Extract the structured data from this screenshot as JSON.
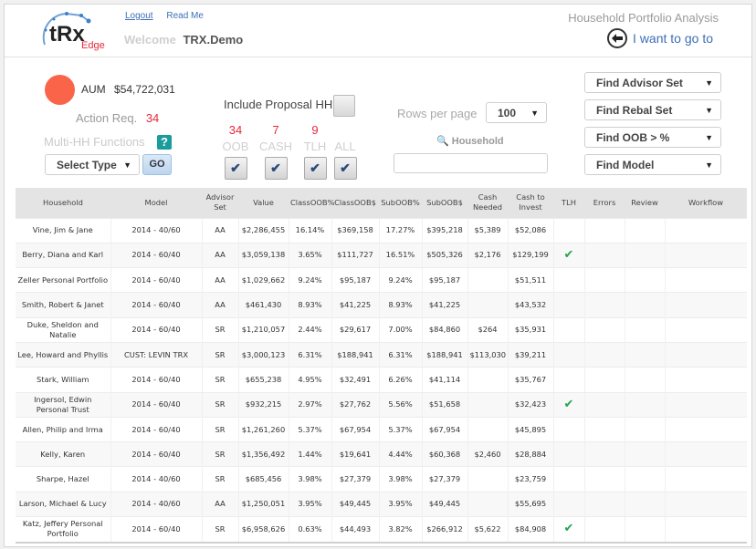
{
  "header": {
    "logo_text": "tRx",
    "logo_sub": "Edge",
    "links": [
      "Logout",
      "Read Me"
    ],
    "welcome_label": "Welcome",
    "username": "TRX.Demo",
    "app_title": "Household Portfolio Analysis",
    "goto_label": "I want to go to"
  },
  "summary": {
    "aum_label": "AUM",
    "aum_value": "$54,722,031",
    "aum_color": "#fa6448",
    "action_label": "Action Req.",
    "action_count": "34",
    "multi_hh_label": "Multi-HH Functions",
    "help_glyph": "?",
    "select_type": "Select Type",
    "go_label": "GO"
  },
  "filters": {
    "include_proposal_label": "Include Proposal HH",
    "items": [
      {
        "count": "34",
        "label": "OOB"
      },
      {
        "count": "7",
        "label": "CASH"
      },
      {
        "count": "9",
        "label": "TLH"
      },
      {
        "count": "",
        "label": "ALL"
      }
    ],
    "rows_per_page_label": "Rows per page",
    "rows_per_page_value": "100",
    "household_search_label": "Household",
    "household_search_value": ""
  },
  "finders": [
    "Find Advisor Set",
    "Find Rebal Set",
    "Find OOB > %",
    "Find Model"
  ],
  "table": {
    "columns": [
      "Household",
      "Model",
      "Advisor Set",
      "Value",
      "ClassOOB%",
      "ClassOOB$",
      "SubOOB%",
      "SubOOB$",
      "Cash Needed",
      "Cash to Invest",
      "TLH",
      "Errors",
      "Review",
      "Workflow"
    ],
    "rows": [
      {
        "household": "Vine, Jim & Jane",
        "model": "2014 - 40/60",
        "advisor": "AA",
        "value": "$2,286,455",
        "class_pct": "16.14%",
        "class_usd": "$369,158",
        "sub_pct": "17.27%",
        "sub_usd": "$395,218",
        "cash_needed": "$5,389",
        "cash_invest": "$52,086",
        "tlh": false
      },
      {
        "household": "Berry, Diana and Karl",
        "model": "2014 - 60/40",
        "advisor": "AA",
        "value": "$3,059,138",
        "class_pct": "3.65%",
        "class_usd": "$111,727",
        "sub_pct": "16.51%",
        "sub_usd": "$505,326",
        "cash_needed": "$2,176",
        "cash_invest": "$129,199",
        "tlh": true
      },
      {
        "household": "Zeller Personal Portfolio",
        "model": "2014 - 60/40",
        "advisor": "AA",
        "value": "$1,029,662",
        "class_pct": "9.24%",
        "class_usd": "$95,187",
        "sub_pct": "9.24%",
        "sub_usd": "$95,187",
        "cash_needed": "",
        "cash_invest": "$51,511",
        "tlh": false
      },
      {
        "household": "Smith, Robert & Janet",
        "model": "2014 - 60/40",
        "advisor": "AA",
        "value": "$461,430",
        "class_pct": "8.93%",
        "class_usd": "$41,225",
        "sub_pct": "8.93%",
        "sub_usd": "$41,225",
        "cash_needed": "",
        "cash_invest": "$43,532",
        "tlh": false
      },
      {
        "household": "Duke, Sheldon and Natalie",
        "model": "2014 - 60/40",
        "advisor": "SR",
        "value": "$1,210,057",
        "class_pct": "2.44%",
        "class_usd": "$29,617",
        "sub_pct": "7.00%",
        "sub_usd": "$84,860",
        "cash_needed": "$264",
        "cash_invest": "$35,931",
        "tlh": false
      },
      {
        "household": "Lee, Howard and Phyllis",
        "model": "CUST: LEVIN TRX",
        "advisor": "SR",
        "value": "$3,000,123",
        "class_pct": "6.31%",
        "class_usd": "$188,941",
        "sub_pct": "6.31%",
        "sub_usd": "$188,941",
        "cash_needed": "$113,030",
        "cash_invest": "$39,211",
        "tlh": false
      },
      {
        "household": "Stark, William",
        "model": "2014 - 60/40",
        "advisor": "SR",
        "value": "$655,238",
        "class_pct": "4.95%",
        "class_usd": "$32,491",
        "sub_pct": "6.26%",
        "sub_usd": "$41,114",
        "cash_needed": "",
        "cash_invest": "$35,767",
        "tlh": false
      },
      {
        "household": "Ingersol, Edwin Personal Trust",
        "model": "2014 - 60/40",
        "advisor": "SR",
        "value": "$932,215",
        "class_pct": "2.97%",
        "class_usd": "$27,762",
        "sub_pct": "5.56%",
        "sub_usd": "$51,658",
        "cash_needed": "",
        "cash_invest": "$32,423",
        "tlh": true
      },
      {
        "household": "Allen, Philip and Irma",
        "model": "2014 - 60/40",
        "advisor": "SR",
        "value": "$1,261,260",
        "class_pct": "5.37%",
        "class_usd": "$67,954",
        "sub_pct": "5.37%",
        "sub_usd": "$67,954",
        "cash_needed": "",
        "cash_invest": "$45,895",
        "tlh": false
      },
      {
        "household": "Kelly, Karen",
        "model": "2014 - 60/40",
        "advisor": "SR",
        "value": "$1,356,492",
        "class_pct": "1.44%",
        "class_usd": "$19,641",
        "sub_pct": "4.44%",
        "sub_usd": "$60,368",
        "cash_needed": "$2,460",
        "cash_invest": "$28,884",
        "tlh": false
      },
      {
        "household": "Sharpe, Hazel",
        "model": "2014 - 40/60",
        "advisor": "SR",
        "value": "$685,456",
        "class_pct": "3.98%",
        "class_usd": "$27,379",
        "sub_pct": "3.98%",
        "sub_usd": "$27,379",
        "cash_needed": "",
        "cash_invest": "$23,759",
        "tlh": false
      },
      {
        "household": "Larson, Michael & Lucy",
        "model": "2014 - 40/60",
        "advisor": "AA",
        "value": "$1,250,051",
        "class_pct": "3.95%",
        "class_usd": "$49,445",
        "sub_pct": "3.95%",
        "sub_usd": "$49,445",
        "cash_needed": "",
        "cash_invest": "$55,695",
        "tlh": false
      },
      {
        "household": "Katz, Jeffery Personal Portfolio",
        "model": "2014 - 60/40",
        "advisor": "SR",
        "value": "$6,958,626",
        "class_pct": "0.63%",
        "class_usd": "$44,493",
        "sub_pct": "3.82%",
        "sub_usd": "$266,912",
        "cash_needed": "$5,622",
        "cash_invest": "$84,908",
        "tlh": true
      }
    ],
    "tlh_icon": "checkmark-icon",
    "tlh_glyph": "✔",
    "tlh_color": "#1fa64a"
  }
}
